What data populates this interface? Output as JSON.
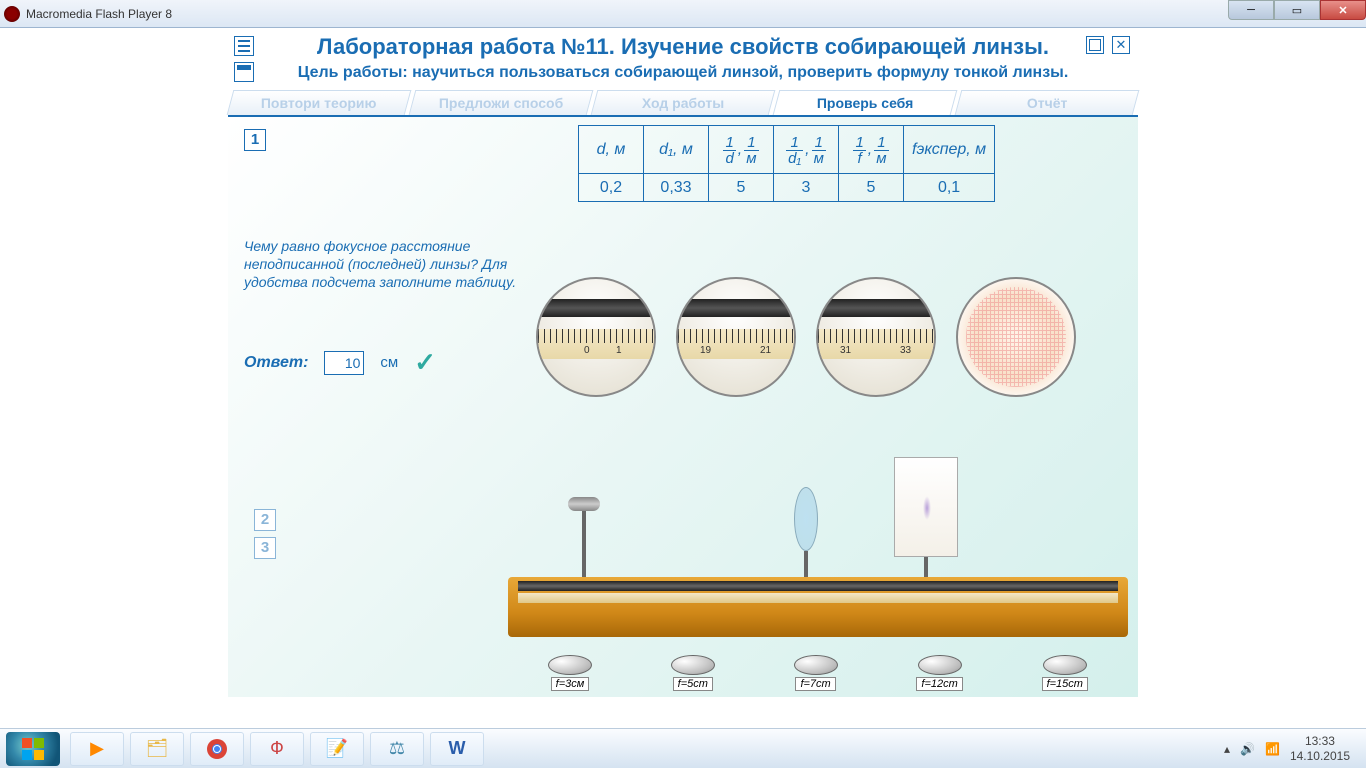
{
  "window": {
    "title": "Macromedia Flash Player 8"
  },
  "header": {
    "title": "Лабораторная работа №11.  Изучение свойств собирающей линзы.",
    "subtitle": "Цель работы: научиться пользоваться собирающей линзой, проверить формулу тонкой линзы."
  },
  "tabs": [
    "Повтори теорию",
    "Предложи способ",
    "Ход работы",
    "Проверь себя",
    "Отчёт"
  ],
  "active_tab_index": 3,
  "steps": {
    "s1": "1",
    "s2": "2",
    "s3": "3"
  },
  "table": {
    "headers": {
      "d": "d, м",
      "d1": "d₁, м",
      "inv_d_num": "1",
      "inv_d_den": "d",
      "inv_d_unit_num": "1",
      "inv_d_unit_den": "м",
      "inv_d1_num": "1",
      "inv_d1_den": "d₁",
      "inv_d1_unit_num": "1",
      "inv_d1_unit_den": "м",
      "inv_f_num": "1",
      "inv_f_den": "f",
      "inv_f_unit_num": "1",
      "inv_f_unit_den": "м",
      "fexp": "fэкспер, м"
    },
    "values": {
      "d": "0,2",
      "d1": "0,33",
      "inv_d": "5",
      "inv_d1": "3",
      "inv_f": "5",
      "fexp": "0,1"
    }
  },
  "question": "Чему равно фокусное расстояние неподписанной (последней) линзы? Для удобства подсчета заполните таблицу.",
  "answer": {
    "label": "Ответ:",
    "value": "10",
    "unit": "см"
  },
  "mag_ticks": {
    "m1a": "0",
    "m1b": "1",
    "m2a": "19",
    "m2b": "21",
    "m3a": "31",
    "m3b": "33"
  },
  "lens_buttons": [
    "f=3см",
    "f=5cm",
    "f=7cm",
    "f=12cm",
    "f=15cm"
  ],
  "tray": {
    "time": "13:33",
    "date": "14.10.2015"
  }
}
